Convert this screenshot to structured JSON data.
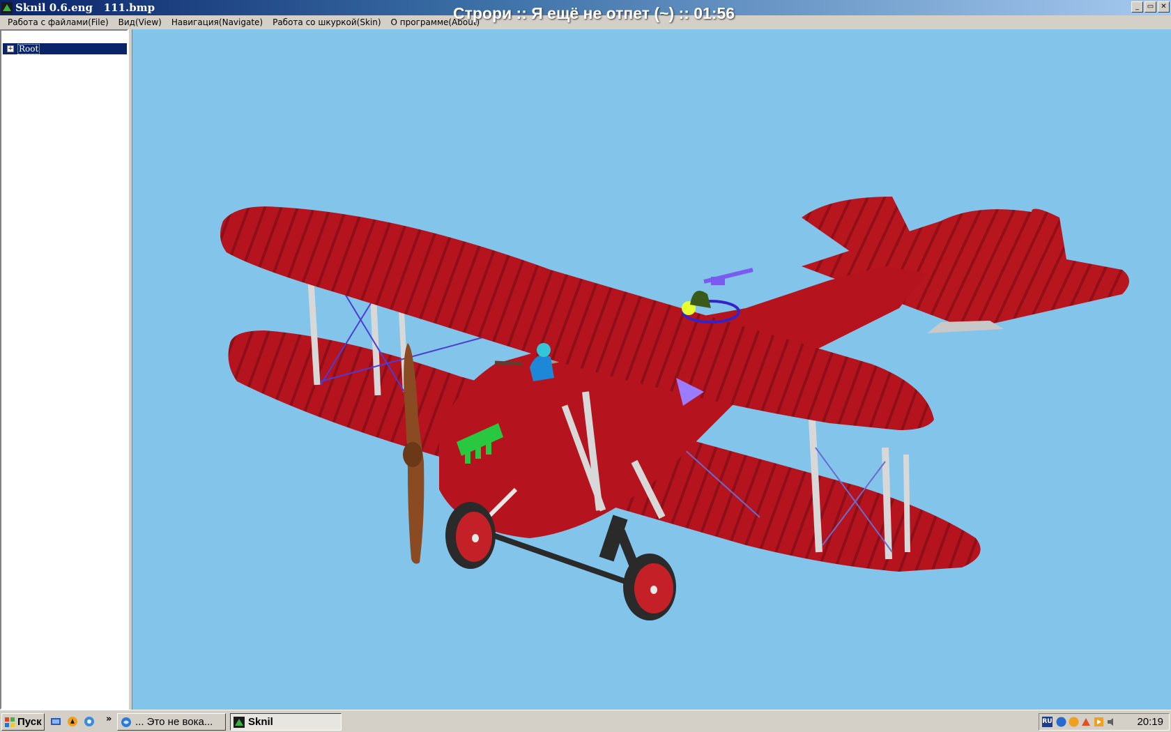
{
  "window": {
    "title": "Sknil 0.6.eng   111.bmp",
    "buttons": {
      "minimize": "_",
      "maximize": "▭",
      "close": "✕"
    }
  },
  "overlay": {
    "text": "Строри :: Я ещё не отпет (~) :: 01:56"
  },
  "menu": {
    "items": [
      "Работа с файлами(File)",
      "Вид(View)",
      "Навигация(Navigate)",
      "Работа со шкуркой(Skin)",
      "О программе(About)"
    ]
  },
  "tree": {
    "root_label": "Root",
    "expander": "+"
  },
  "viewport": {
    "background": "#83c4ea",
    "model_color": "#b5141e"
  },
  "taskbar": {
    "start_label": "Пуск",
    "chevron": "»",
    "tasks": [
      {
        "label": "... Это не вока...",
        "active": false
      },
      {
        "label": "Sknil",
        "active": true
      }
    ],
    "lang": "RU",
    "clock": "20:19"
  }
}
